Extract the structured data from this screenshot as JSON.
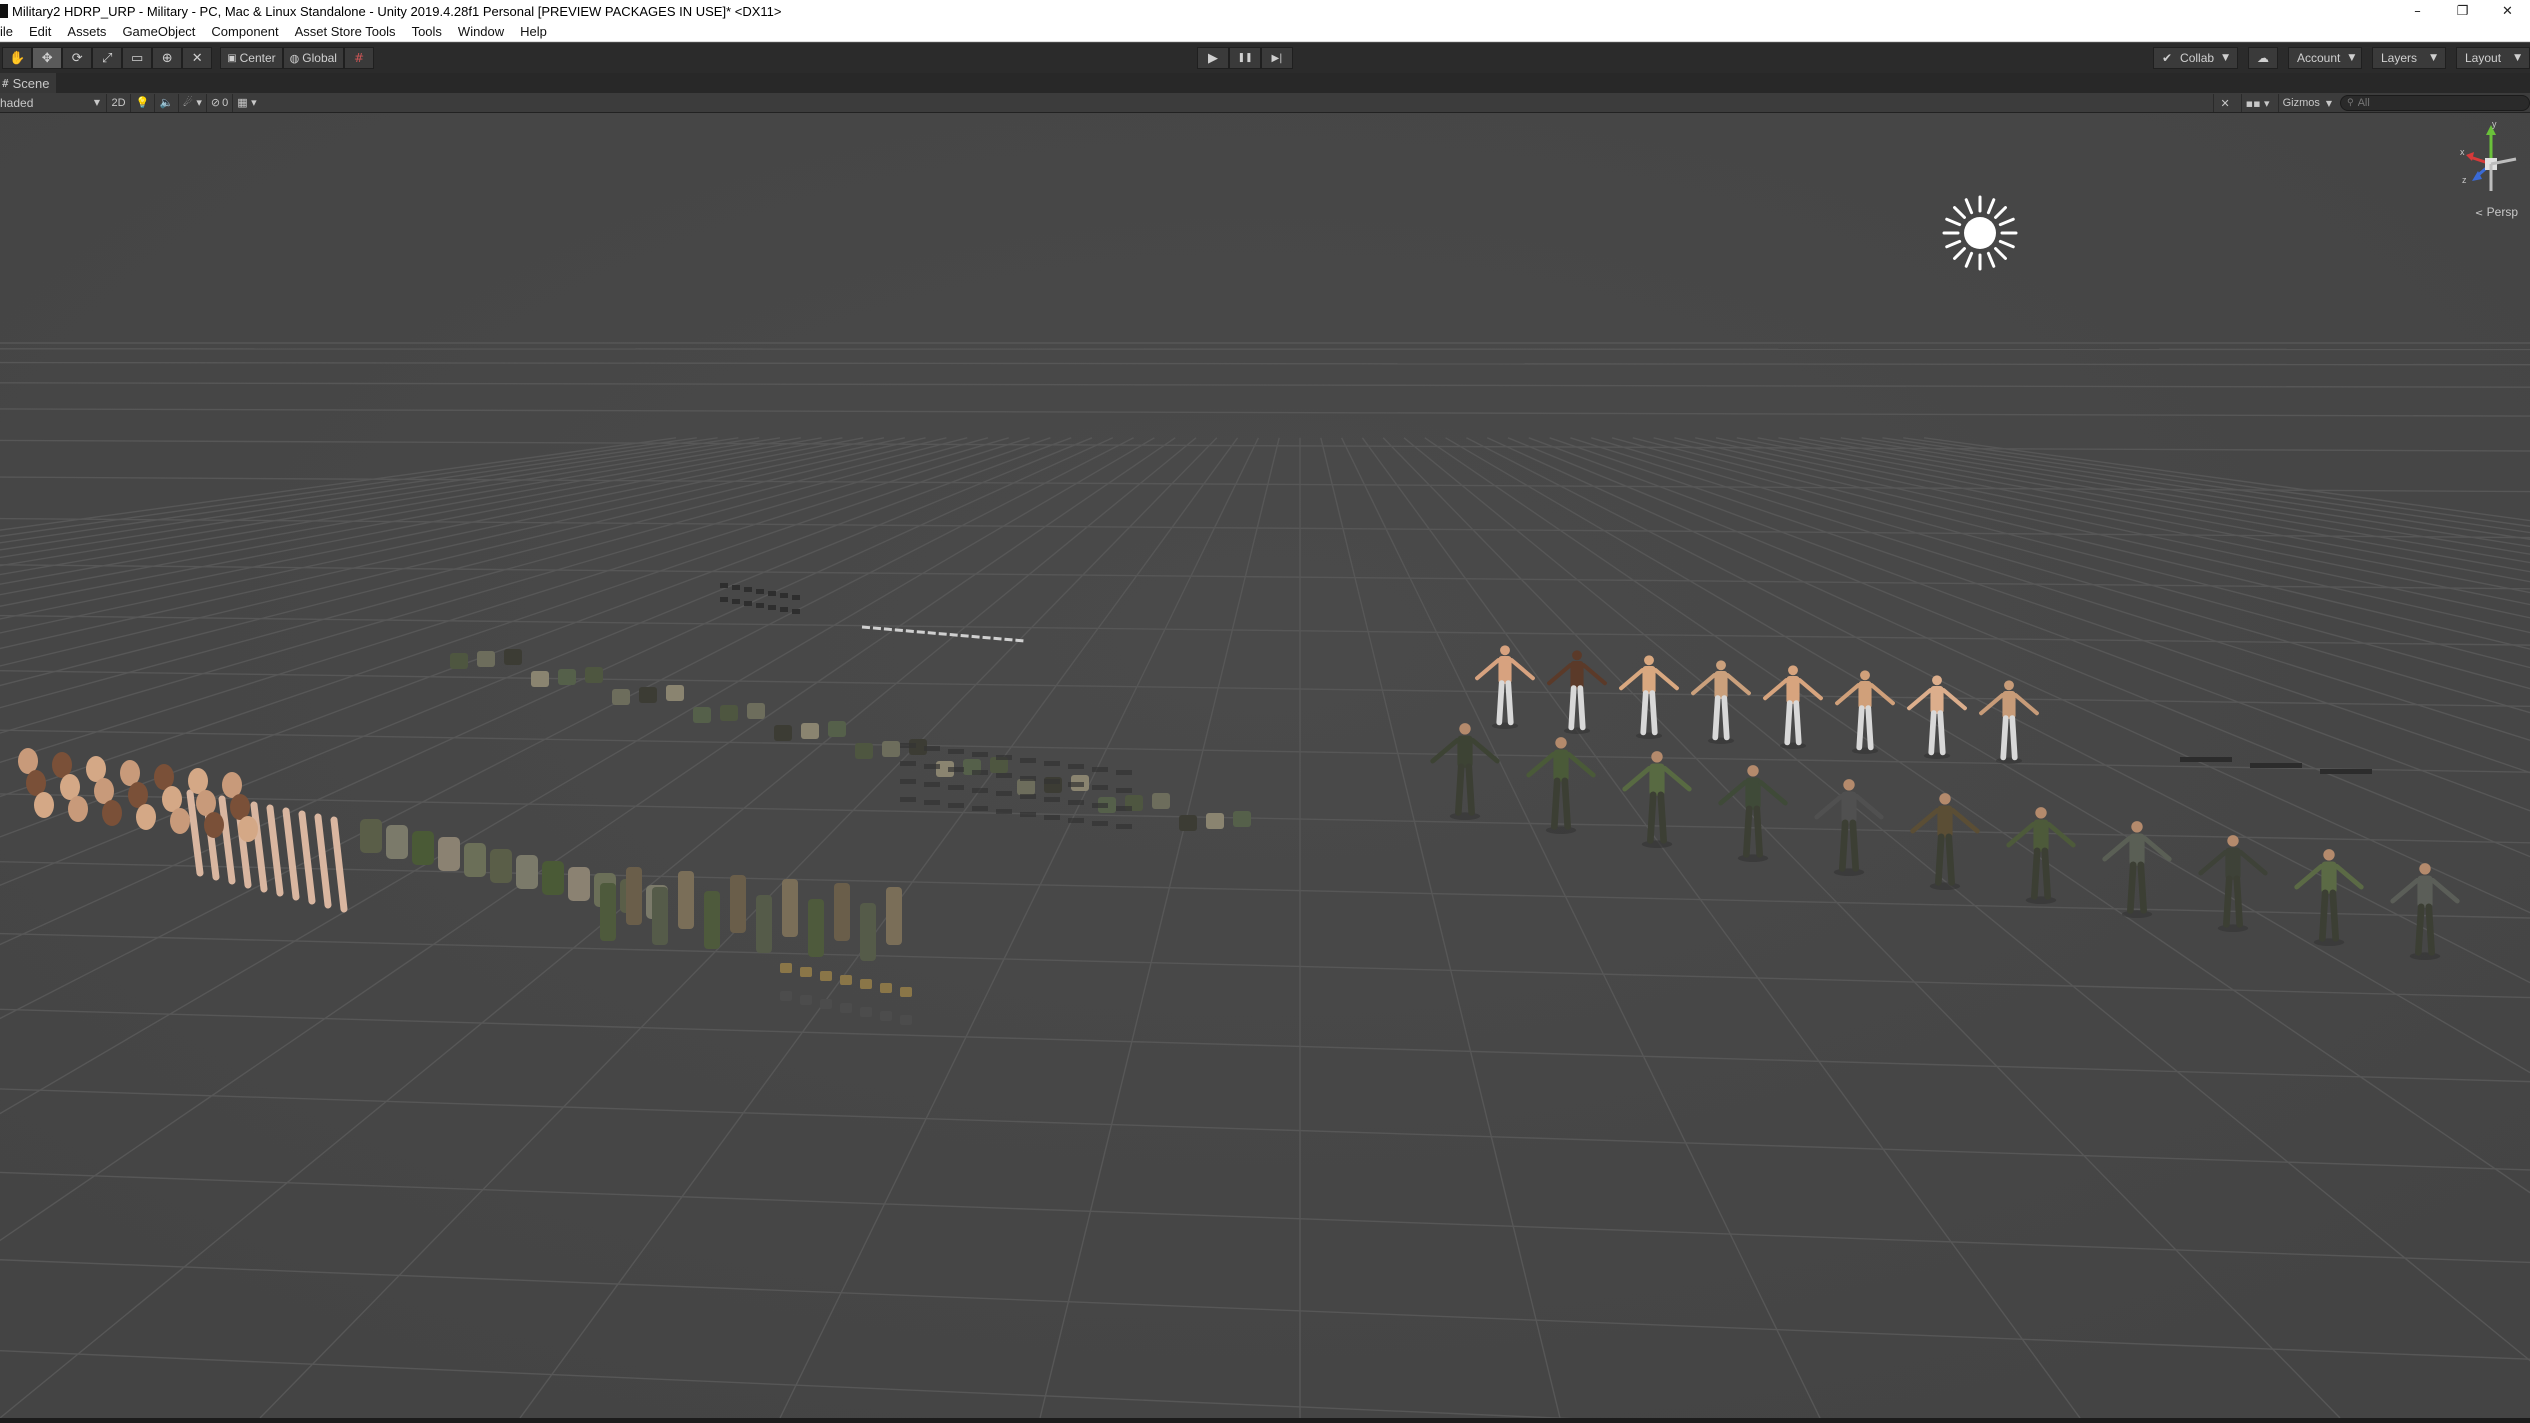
{
  "window": {
    "title": "Military2 HDRP_URP - Military - PC, Mac & Linux Standalone - Unity 2019.4.28f1 Personal [PREVIEW PACKAGES IN USE]* <DX11>",
    "minimize_glyph": "–",
    "restore_glyph": "❐",
    "close_glyph": "✕"
  },
  "menu": [
    "ile",
    "Edit",
    "Assets",
    "GameObject",
    "Component",
    "Asset Store Tools",
    "Tools",
    "Window",
    "Help"
  ],
  "toolbar": {
    "transform_tools": [
      {
        "name": "hand-tool",
        "glyph": "✋"
      },
      {
        "name": "move-tool",
        "glyph": "✥"
      },
      {
        "name": "rotate-tool",
        "glyph": "⟳"
      },
      {
        "name": "scale-tool",
        "glyph": "⤢"
      },
      {
        "name": "rect-tool",
        "glyph": "▭"
      },
      {
        "name": "transform-tool",
        "glyph": "⊕"
      },
      {
        "name": "custom-tool",
        "glyph": "✕"
      }
    ],
    "pivot_label": "Center",
    "space_label": "Global",
    "play_glyph": "▶",
    "pause_glyph": "❚❚",
    "step_glyph": "▶|",
    "collab_label": "Collab",
    "account_label": "Account",
    "layers_label": "Layers",
    "layout_label": "Layout"
  },
  "scene": {
    "tab_label": "Scene",
    "shading_mode": "haded",
    "mode_2d_label": "2D",
    "hidden_count": "0",
    "gizmos_label": "Gizmos",
    "search_placeholder": "All",
    "projection_label": "Persp",
    "axis_x": "x",
    "axis_y": "y",
    "axis_z": "z"
  },
  "colors": {
    "viewport_bg": "#474747",
    "grid_line": "#555555",
    "toolbar_bg": "#2b2b2b",
    "sun": "#ffffff",
    "axis_x": "#d63a3a",
    "axis_y": "#6ac13a",
    "axis_z": "#3a6ad6"
  }
}
